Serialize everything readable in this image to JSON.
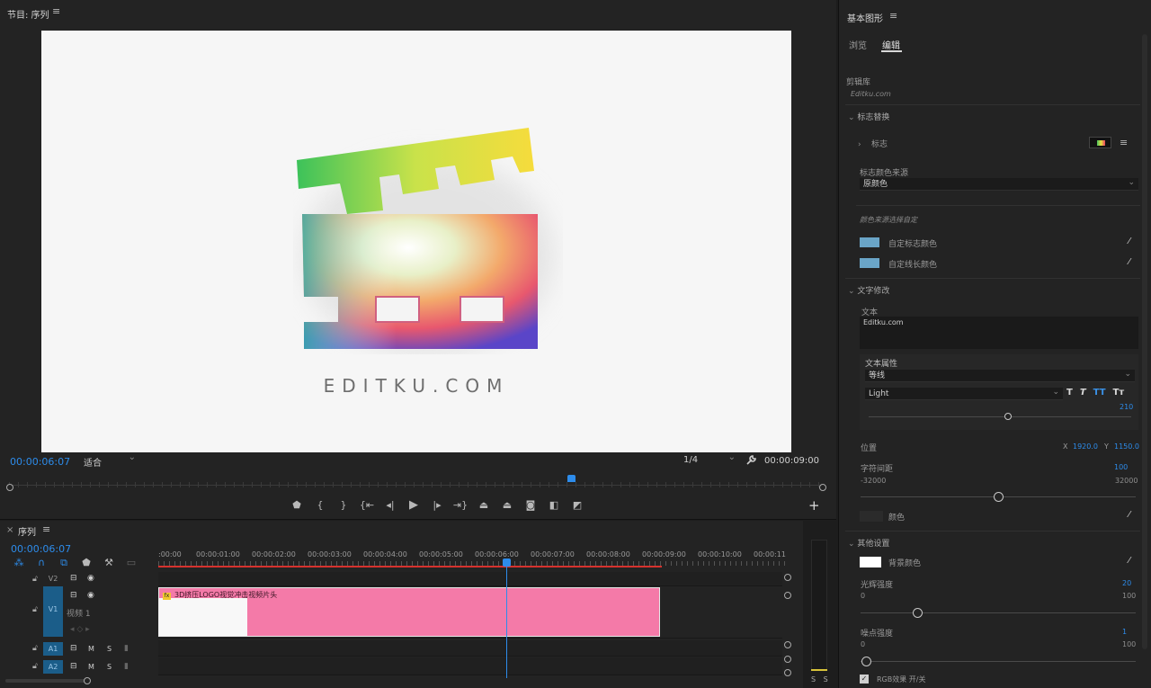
{
  "program_monitor": {
    "title": "节目: 序列",
    "menu_icon": "≡",
    "viewer_text": "EDITKU.COM",
    "timecode_current": "00:00:06:07",
    "fit_label": "适合",
    "resolution_label": "1/4",
    "timecode_duration": "00:00:09:00",
    "transport_icons": [
      "marker-icon",
      "mark-in-icon",
      "mark-out-icon",
      "go-to-in-icon",
      "step-back-icon",
      "play-icon",
      "step-forward-icon",
      "go-to-out-icon",
      "lift-icon",
      "extract-icon",
      "export-frame-icon",
      "compare-icon",
      "comparison-view-icon"
    ],
    "add_label": "+"
  },
  "timeline": {
    "close": "×",
    "title": "序列",
    "menu_icon": "≡",
    "timecode": "00:00:06:07",
    "ruler_labels": [
      ":00:00",
      "00:00:01:00",
      "00:00:02:00",
      "00:00:03:00",
      "00:00:04:00",
      "00:00:05:00",
      "00:00:06:00",
      "00:00:07:00",
      "00:00:08:00",
      "00:00:09:00",
      "00:00:10:00",
      "00:00:11"
    ],
    "tracks": {
      "v2": "V2",
      "v1": "V1",
      "v1_name": "视频 1",
      "a1": "A1",
      "a2": "A2",
      "m": "M",
      "s": "S"
    },
    "clip": {
      "fx": "fx",
      "label": "3D挤压LOGO视觉冲击视频片头"
    }
  },
  "meter": {
    "solo_labels": "S S"
  },
  "essential_graphics": {
    "title": "基本图形",
    "menu_icon": "≡",
    "tab_browse": "浏览",
    "tab_edit": "编辑",
    "clip_library": "剪辑库",
    "clip_library_value": "Editku.com",
    "logo_replace": "标志替换",
    "logo": "标志",
    "logo_color_source": "标志颜色来源",
    "logo_color_value": "原颜色",
    "color_source_custom": "颜色来源选择自定",
    "custom_logo_color": "自定标志颜色",
    "custom_line_color": "自定线长颜色",
    "text_edit": "文字修改",
    "text_label": "文本",
    "text_value": "Editku.com",
    "text_props": "文本属性",
    "font_family": "等线",
    "font_style": "Light",
    "font_size": "210",
    "style_buttons": [
      "T",
      "T",
      "TT",
      "Tт"
    ],
    "position": "位置",
    "pos_x_label": "X",
    "pos_x": "1920.0",
    "pos_y_label": "Y",
    "pos_y": "1150.0",
    "tracking": "字符间距",
    "tracking_value": "100",
    "tracking_min": "-32000",
    "tracking_max": "32000",
    "color": "颜色",
    "other_settings": "其他设置",
    "bg_color": "背景颜色",
    "glow": "光辉强度",
    "glow_value": "20",
    "glow_min": "0",
    "glow_max": "100",
    "noise": "噪点强度",
    "noise_value": "1",
    "noise_min": "0",
    "noise_max": "100",
    "rgb_toggle": "RGB效果 开/关"
  }
}
